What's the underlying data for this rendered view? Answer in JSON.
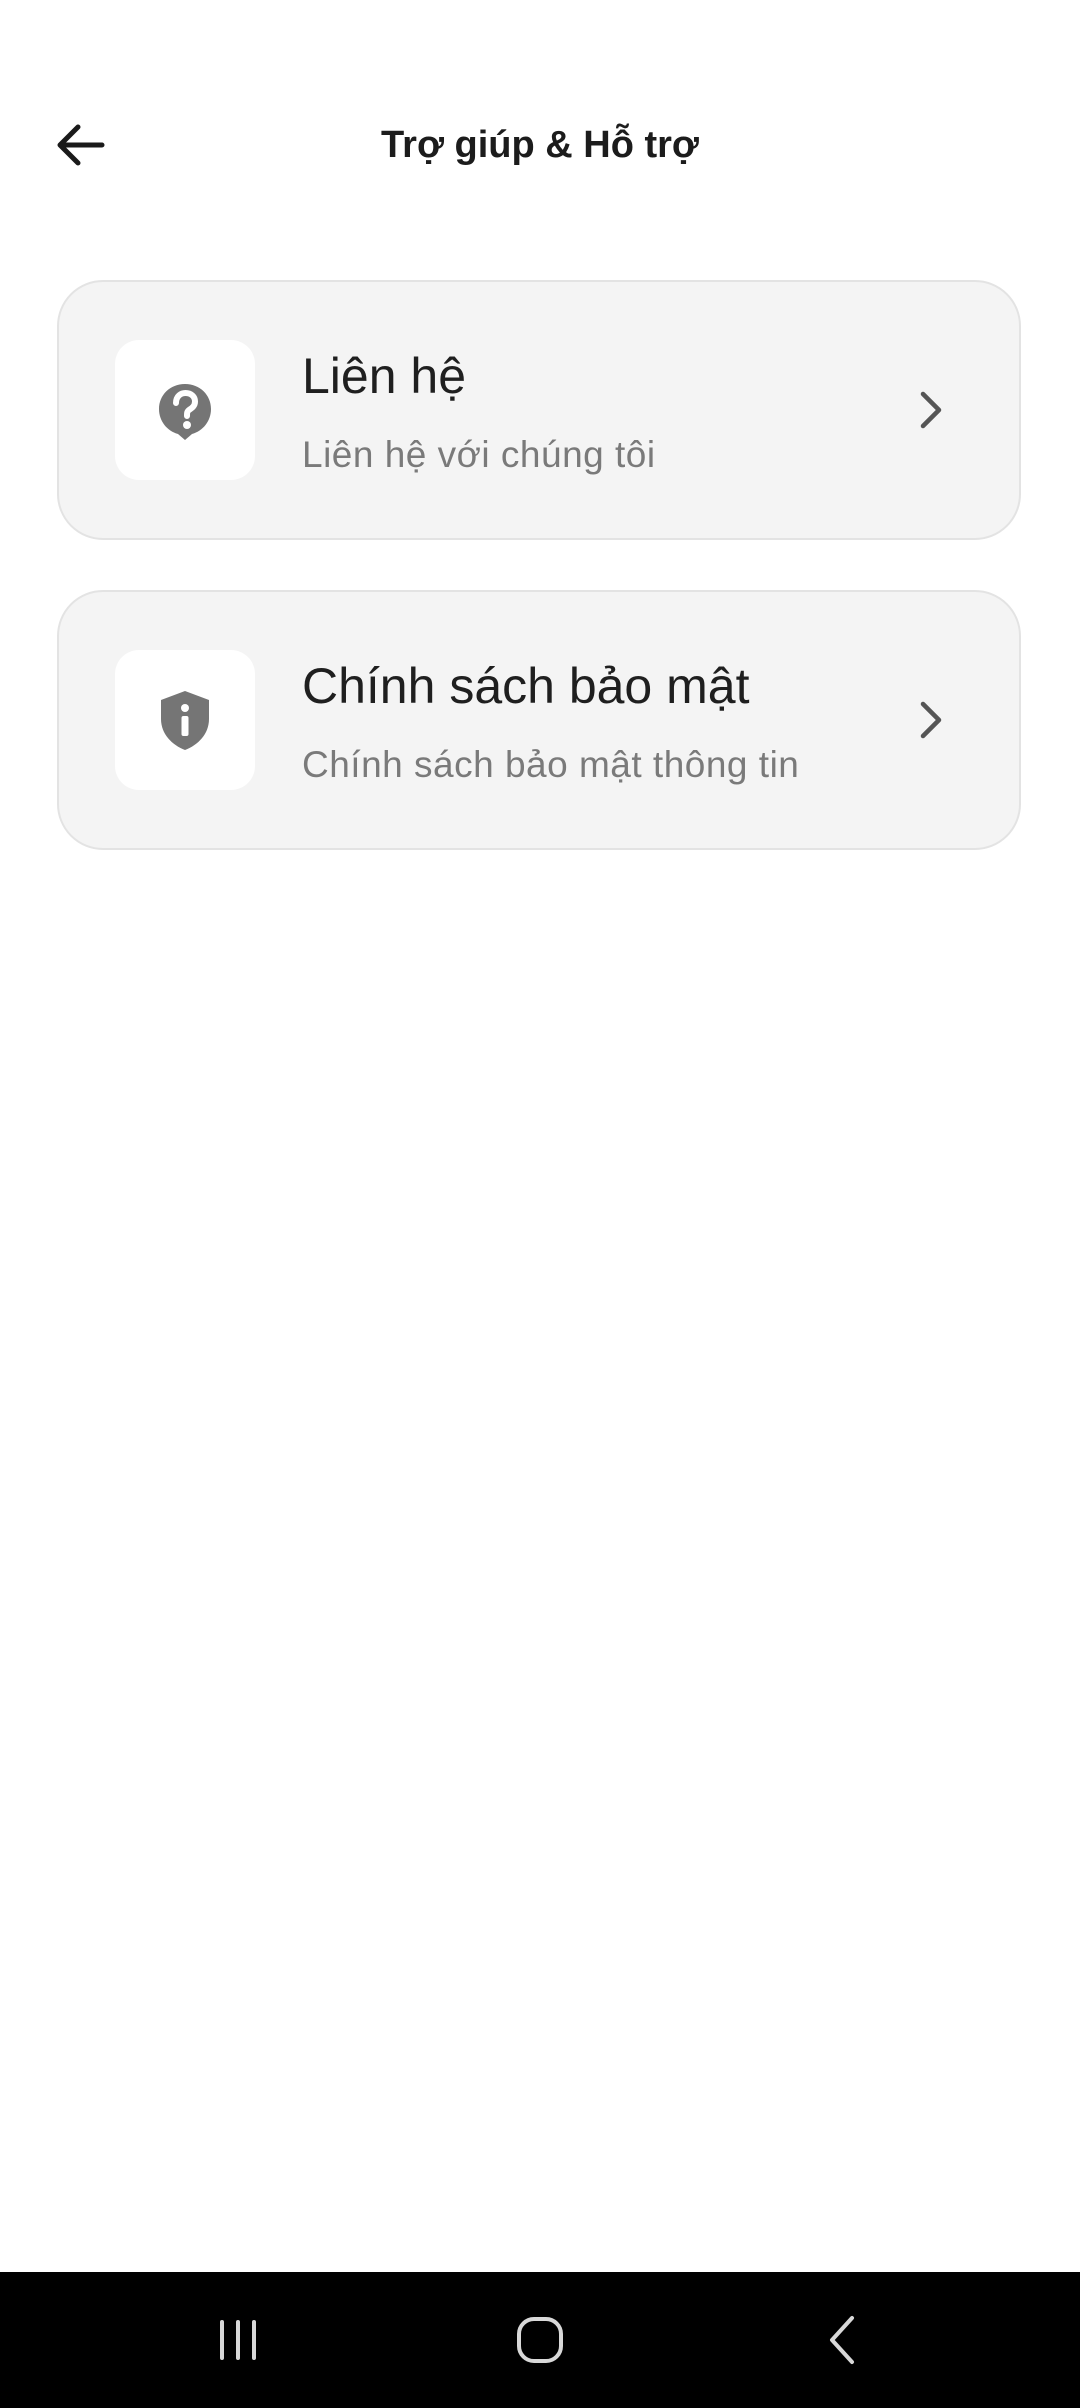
{
  "header": {
    "title": "Trợ giúp & Hỗ trợ",
    "back_icon": "arrow-left-icon"
  },
  "menu": {
    "items": [
      {
        "title": "Liên hệ",
        "subtitle": "Liên hệ với chúng tôi",
        "icon": "help-circle-icon"
      },
      {
        "title": "Chính sách bảo mật",
        "subtitle": "Chính sách bảo mật thông tin",
        "icon": "shield-info-icon"
      }
    ]
  },
  "navbar": {
    "icons": [
      "recent-apps-icon",
      "home-icon",
      "system-back-icon"
    ]
  },
  "colors": {
    "card_background": "#f4f4f4",
    "card_border": "#e3e3e3",
    "icon_gray": "#757575",
    "nav_background": "#000000"
  }
}
